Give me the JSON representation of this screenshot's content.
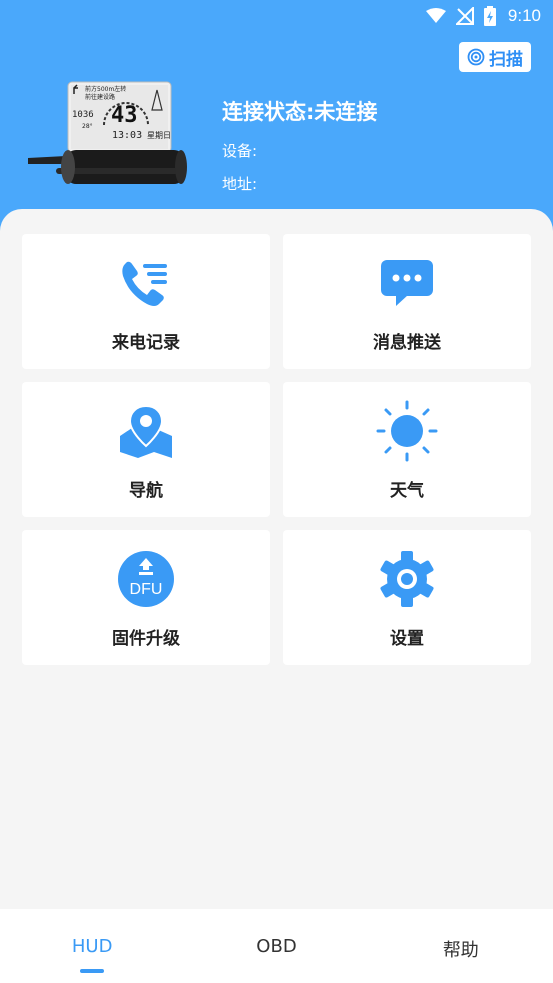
{
  "status_bar": {
    "time": "9:10"
  },
  "header": {
    "scan_label": "扫描",
    "connection_status": "连接状态:未连接",
    "device_label": "设备:",
    "address_label": "地址:"
  },
  "device_screen": {
    "line1": "前方500m左转",
    "line2": "前往建设路",
    "speed": "43",
    "trip": "1036",
    "clock": "13:03",
    "temp": "28°",
    "weekday": "星期日"
  },
  "grid": [
    {
      "label": "来电记录",
      "icon": "phone-list-icon"
    },
    {
      "label": "消息推送",
      "icon": "message-bubble-icon"
    },
    {
      "label": "导航",
      "icon": "map-pin-icon"
    },
    {
      "label": "天气",
      "icon": "sun-icon"
    },
    {
      "label": "固件升级",
      "icon": "dfu-upgrade-icon",
      "icon_text": "DFU"
    },
    {
      "label": "设置",
      "icon": "gear-icon"
    }
  ],
  "bottom_nav": [
    {
      "label": "HUD",
      "active": true
    },
    {
      "label": "OBD",
      "active": false
    },
    {
      "label": "帮助",
      "active": false
    }
  ],
  "colors": {
    "primary": "#4aa8fb",
    "accent": "#3a9af5"
  }
}
